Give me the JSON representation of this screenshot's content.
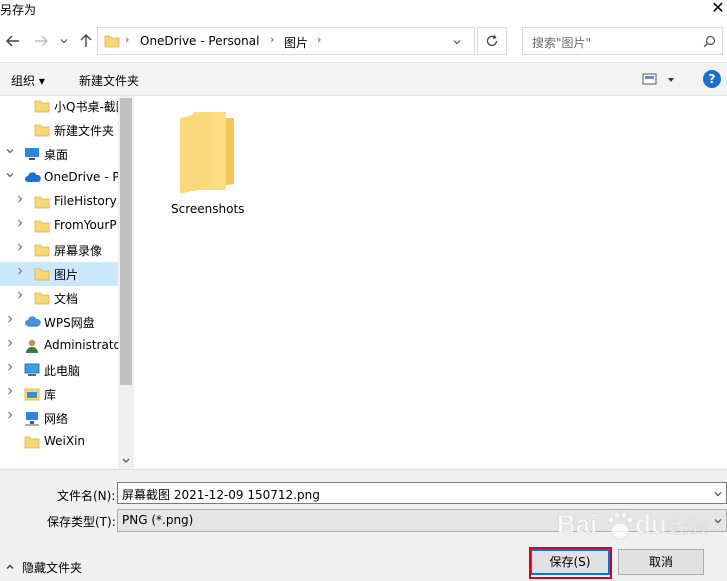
{
  "window": {
    "title": "另存为",
    "close_glyph": "✕"
  },
  "nav": {
    "breadcrumb": [
      "OneDrive - Personal",
      "图片"
    ],
    "search_placeholder": "搜索\"图片\""
  },
  "toolbar": {
    "organize": "组织 ▾",
    "new_folder": "新建文件夹"
  },
  "sidebar": {
    "items": [
      {
        "label": "小Q书桌-截图",
        "icon": "folder-icon",
        "expand": "",
        "indent": 1
      },
      {
        "label": "新建文件夹",
        "icon": "folder-icon",
        "expand": "",
        "indent": 1
      },
      {
        "label": "桌面",
        "icon": "desktop-icon",
        "expand": "expanded",
        "indent": 0
      },
      {
        "label": "OneDrive - P",
        "icon": "onedrive-icon",
        "expand": "expanded",
        "indent": 0
      },
      {
        "label": "FileHistory",
        "icon": "folder-icon",
        "expand": "collapsed",
        "indent": 1
      },
      {
        "label": "FromYourP",
        "icon": "folder-icon",
        "expand": "collapsed",
        "indent": 1
      },
      {
        "label": "屏幕录像",
        "icon": "folder-icon",
        "expand": "collapsed",
        "indent": 1
      },
      {
        "label": "图片",
        "icon": "folder-icon",
        "expand": "collapsed",
        "indent": 1,
        "selected": true
      },
      {
        "label": "文档",
        "icon": "folder-icon",
        "expand": "collapsed",
        "indent": 1
      },
      {
        "label": "WPS网盘",
        "icon": "wps-cloud-icon",
        "expand": "collapsed",
        "indent": 0
      },
      {
        "label": "Administrato",
        "icon": "user-icon",
        "expand": "collapsed",
        "indent": 0
      },
      {
        "label": "此电脑",
        "icon": "computer-icon",
        "expand": "collapsed",
        "indent": 0
      },
      {
        "label": "库",
        "icon": "library-icon",
        "expand": "collapsed",
        "indent": 0
      },
      {
        "label": "网络",
        "icon": "network-icon",
        "expand": "collapsed",
        "indent": 0
      },
      {
        "label": "WeiXin",
        "icon": "folder-icon",
        "expand": "",
        "indent": 0
      }
    ]
  },
  "content": {
    "items": [
      {
        "name": "Screenshots",
        "icon": "folder-icon"
      }
    ]
  },
  "bottom": {
    "filename_label": "文件名(N):",
    "filename_value": "屏幕截图 2021-12-09 150712.png",
    "filetype_label": "保存类型(T):",
    "filetype_value": "PNG (*.png)",
    "hide_folders": "隐藏文件夹",
    "save": "保存(S)",
    "cancel": "取消"
  },
  "colors": {
    "selection": "#cce8ff",
    "folder": "#f8d775",
    "accent": "#0078d7",
    "highlight_box": "#d6001c"
  }
}
